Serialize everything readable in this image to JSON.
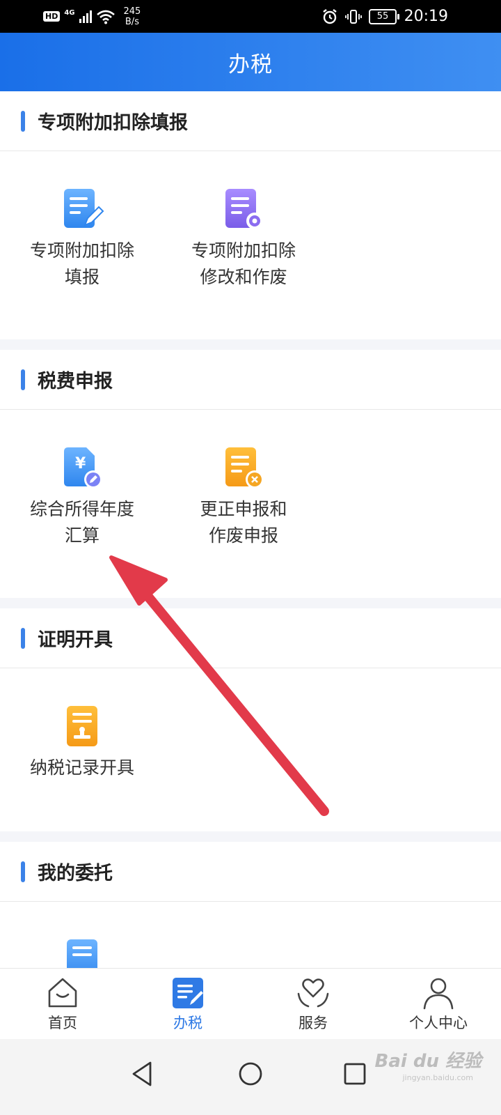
{
  "status_bar": {
    "hd": "HD",
    "network": "4G",
    "speed_value": "245",
    "speed_unit": "B/s",
    "battery": "55",
    "time": "20:19"
  },
  "header": {
    "title": "办税"
  },
  "sections": [
    {
      "title": "专项附加扣除填报",
      "items": [
        {
          "label": "专项附加扣除\n填报",
          "icon": "form-edit-icon",
          "color": "#3a8ff0"
        },
        {
          "label": "专项附加扣除\n修改和作废",
          "icon": "form-settings-icon",
          "color": "#8b6cf0"
        }
      ]
    },
    {
      "title": "税费申报",
      "items": [
        {
          "label": "综合所得年度\n汇算",
          "icon": "yuan-document-icon",
          "color": "#3a8ff0"
        },
        {
          "label": "更正申报和\n作废申报",
          "icon": "form-cancel-icon",
          "color": "#f5a623"
        }
      ]
    },
    {
      "title": "证明开具",
      "items": [
        {
          "label": "纳税记录开具",
          "icon": "stamp-document-icon",
          "color": "#f5a623"
        }
      ]
    },
    {
      "title": "我的委托",
      "items": []
    }
  ],
  "bottom_nav": [
    {
      "label": "首页",
      "icon": "home-icon",
      "active": false
    },
    {
      "label": "办税",
      "icon": "tax-icon",
      "active": true
    },
    {
      "label": "服务",
      "icon": "service-heart-icon",
      "active": false
    },
    {
      "label": "个人中心",
      "icon": "person-icon",
      "active": false
    }
  ],
  "watermark": {
    "text": "Bai du 经验",
    "sub": "jingyan.baidu.com"
  },
  "colors": {
    "primary": "#2f7ae5",
    "arrow": "#e23a4a"
  }
}
